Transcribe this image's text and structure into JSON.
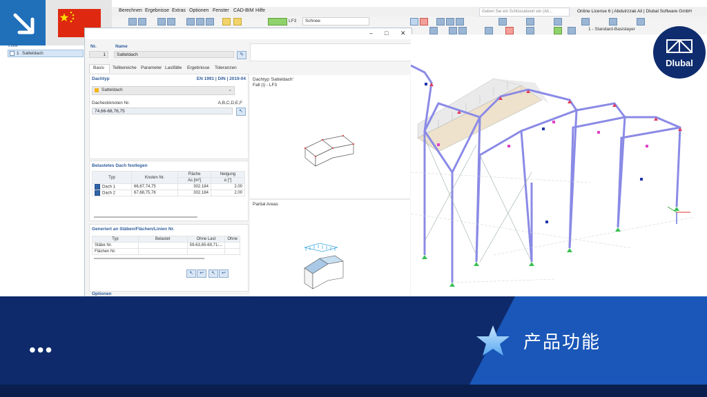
{
  "menu": {
    "items": [
      "Berechnen",
      "Ergebnisse",
      "Extras",
      "Optionen",
      "Fenster",
      "CAD-BIM",
      "Hilfe"
    ],
    "search_placeholder": "Geben Sie ein Schlüsselwort ein (Alt...",
    "license": "Online License 6 | Abdulrzzak Ali | Dlubal Software GmbH"
  },
  "toolbar": {
    "load_case": "LF3",
    "load_case_name": "Schnee",
    "layer": "1 - Standard-Basislayer"
  },
  "left_panel": {
    "header": "Liste",
    "item_no": "1",
    "item_name": "Satteldach"
  },
  "dialog": {
    "nr_label": "Nr.",
    "nr_value": "1",
    "name_label": "Name",
    "name_value": "Satteldach",
    "tabs": [
      "Basis",
      "Teilbereiche",
      "Parameter",
      "Lastfälle",
      "Ergebnisse",
      "Toleranzen"
    ],
    "dachtyp_label": "Dachtyp",
    "norm": "EN 1991 | DIN | 2019-04",
    "dachtyp_value": "Satteldach",
    "eckknoten_label": "Dacheckknoten Nr.",
    "eckknoten_hint": "A,B,C,D,E,F",
    "eckknoten_value": "74,66-68,76,75",
    "belastet_title": "Belastetes Dach festlegen",
    "table": {
      "headers": [
        "Typ",
        "Knoten Nr.",
        "Fläche",
        "Neigung"
      ],
      "subheaders": [
        "",
        "",
        "As [m²]",
        "α [°]"
      ],
      "rows": [
        {
          "typ": "Dach 1",
          "knoten": "66,67,74,75",
          "flaeche": "302.184",
          "neigung": "2.00"
        },
        {
          "typ": "Dach 2",
          "knoten": "67,68,75,76",
          "flaeche": "302.184",
          "neigung": "2.00"
        }
      ]
    },
    "generiert_title": "Generiert an Stäben/Flächen/Linien Nr.",
    "gen_table": {
      "headers": [
        "Typ",
        "Belastet",
        "Ohne Last",
        "Ohne"
      ],
      "rows": [
        {
          "typ": "Stäbe Nr.",
          "belastet": "",
          "ohne_last": "59-63,65-69,71-...",
          "ohne": ""
        },
        {
          "typ": "Flächen Nr.",
          "belastet": "",
          "ohne_last": "",
          "ohne": ""
        }
      ]
    },
    "optionen_title": "Optionen",
    "preview_title": "Dachtyp 'Satteldach'",
    "preview_subtitle": "Fall (i) - LF3",
    "partial_title": "Partial Areas"
  },
  "brand": {
    "logo_text": "Dlubal"
  },
  "banner": {
    "product_features": "产品功能",
    "dots": "•••"
  },
  "colors": {
    "banner_dark": "#0e2a6b",
    "banner_light": "#1a57b8",
    "dlubal_navy": "#0f2d6e",
    "accent_blue": "#1f6fb9",
    "china_red": "#de2910",
    "star_yellow": "#ffde00",
    "frame_blue": "#8a8ae6"
  },
  "icons": [
    "arrow-down-right-icon",
    "china-flag-icon",
    "dlubal-bridge-icon",
    "star-icon",
    "search-icon",
    "close-icon",
    "maximize-icon",
    "minimize-icon"
  ]
}
